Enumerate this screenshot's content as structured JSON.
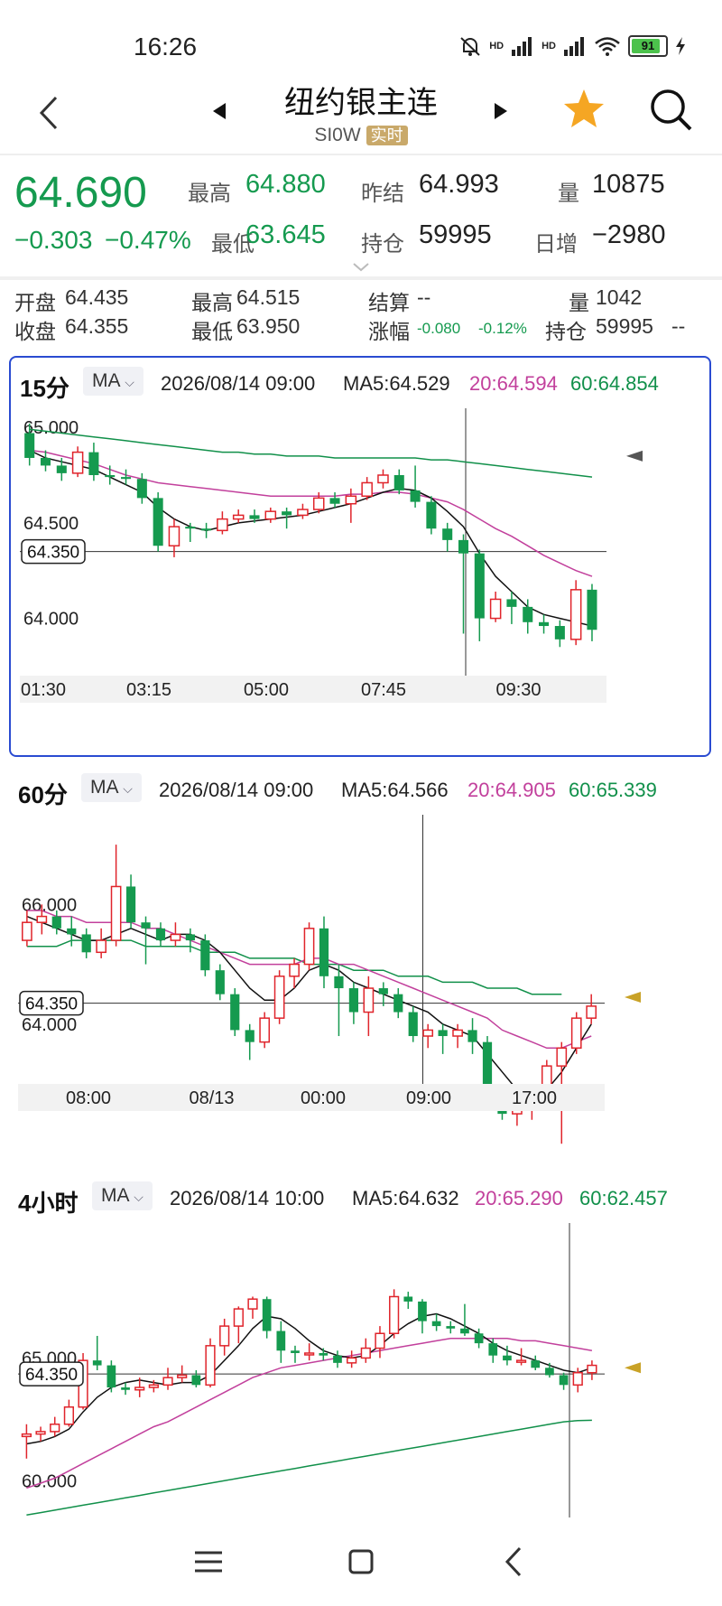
{
  "status": {
    "time": "16:26",
    "battery": "91",
    "net1": "HD",
    "net2": "HD"
  },
  "header": {
    "title": "纽约银主连",
    "symbol": "SI0W",
    "badge": "实时"
  },
  "quote": {
    "price": "64.690",
    "change": "−0.303",
    "change_pct": "−0.47%",
    "high_label": "最高",
    "high": "64.880",
    "low_label": "最低",
    "low": "63.645",
    "prev_label": "昨结",
    "prev": "64.993",
    "oi_label": "持仓",
    "oi": "59995",
    "vol_label": "量",
    "vol": "10875",
    "daily_label": "日增",
    "daily": "−2980"
  },
  "bar_quote": {
    "open_label": "开盘",
    "open": "64.435",
    "close_label": "收盘",
    "close": "64.355",
    "high_label": "最高",
    "high": "64.515",
    "low_label": "最低",
    "low": "63.950",
    "settle_label": "结算",
    "settle": "--",
    "chg_label": "涨幅",
    "chg": "-0.080",
    "chg_pct": "-0.12%",
    "vol_label": "量",
    "vol": "1042",
    "oi_label": "持仓",
    "oi": "59995",
    "oi_tail": "--"
  },
  "colors": {
    "up": "#e0242b",
    "down": "#159a4f",
    "ma5": "#111111",
    "ma20": "#c2409c",
    "ma60": "#11904a",
    "accent": "#f5a623"
  },
  "icons": {
    "back": "back-icon",
    "prev": "triangle-left-icon",
    "next": "triangle-right-icon",
    "star": "star-icon",
    "search": "search-icon"
  },
  "panels": [
    {
      "period": "15分",
      "indicator": "MA",
      "datetime": "2026/08/14 09:00",
      "ma5": "MA5:64.529",
      "ma20": "20:64.594",
      "ma60": "60:64.854",
      "price_tag": "64.350",
      "ylabels": [
        "65.000",
        "64.500",
        "64.000"
      ],
      "xlabels": [
        "01:30",
        "03:15",
        "05:00",
        "07:45",
        "09:30"
      ]
    },
    {
      "period": "60分",
      "indicator": "MA",
      "datetime": "2026/08/14 09:00",
      "ma5": "MA5:64.566",
      "ma20": "20:64.905",
      "ma60": "60:65.339",
      "price_tag": "64.350",
      "ylabels": [
        "66.000",
        "64.000"
      ],
      "xlabels": [
        "08:00",
        "08/13",
        "00:00",
        "09:00",
        "17:00"
      ]
    },
    {
      "period": "4小时",
      "indicator": "MA",
      "datetime": "2026/08/14 10:00",
      "ma5": "MA5:64.632",
      "ma20": "20:65.290",
      "ma60": "60:62.457",
      "price_tag": "64.350",
      "ylabels": [
        "65.000",
        "60.000"
      ],
      "xlabels": []
    }
  ],
  "chart_data": [
    {
      "type": "candlestick",
      "title": "15分",
      "ylim": [
        63.7,
        65.1
      ],
      "candles": [
        [
          64.97,
          64.84,
          65.02,
          64.8
        ],
        [
          64.84,
          64.8,
          64.88,
          64.77
        ],
        [
          64.8,
          64.76,
          64.84,
          64.72
        ],
        [
          64.76,
          64.87,
          64.9,
          64.74
        ],
        [
          64.87,
          64.75,
          64.92,
          64.72
        ],
        [
          64.75,
          64.74,
          64.8,
          64.7
        ],
        [
          64.74,
          64.73,
          64.78,
          64.7
        ],
        [
          64.73,
          64.63,
          64.76,
          64.6
        ],
        [
          64.63,
          64.38,
          64.66,
          64.35
        ],
        [
          64.38,
          64.48,
          64.52,
          64.32
        ],
        [
          64.48,
          64.47,
          64.5,
          64.4
        ],
        [
          64.47,
          64.46,
          64.5,
          64.42
        ],
        [
          64.46,
          64.52,
          64.56,
          64.44
        ],
        [
          64.52,
          64.54,
          64.57,
          64.5
        ],
        [
          64.54,
          64.52,
          64.57,
          64.5
        ],
        [
          64.52,
          64.56,
          64.58,
          64.5
        ],
        [
          64.56,
          64.54,
          64.58,
          64.47
        ],
        [
          64.54,
          64.57,
          64.6,
          64.52
        ],
        [
          64.57,
          64.63,
          64.66,
          64.55
        ],
        [
          64.63,
          64.6,
          64.66,
          64.58
        ],
        [
          64.6,
          64.64,
          64.68,
          64.5
        ],
        [
          64.64,
          64.71,
          64.74,
          64.62
        ],
        [
          64.71,
          64.75,
          64.78,
          64.68
        ],
        [
          64.75,
          64.67,
          64.78,
          64.65
        ],
        [
          64.67,
          64.61,
          64.8,
          64.58
        ],
        [
          64.61,
          64.47,
          64.64,
          64.44
        ],
        [
          64.47,
          64.41,
          64.5,
          64.35
        ],
        [
          64.41,
          64.34,
          64.44,
          63.92
        ],
        [
          64.34,
          64.0,
          64.36,
          63.88
        ],
        [
          64.0,
          64.1,
          64.14,
          63.98
        ],
        [
          64.1,
          64.06,
          64.14,
          63.97
        ],
        [
          64.06,
          63.98,
          64.1,
          63.92
        ],
        [
          63.98,
          63.96,
          64.02,
          63.92
        ],
        [
          63.96,
          63.89,
          63.99,
          63.85
        ],
        [
          63.89,
          64.15,
          64.2,
          63.86
        ],
        [
          64.15,
          63.94,
          64.18,
          63.88
        ]
      ],
      "ma5": [
        64.88,
        64.84,
        64.82,
        64.8,
        64.78,
        64.74,
        64.7,
        64.66,
        64.58,
        64.52,
        64.48,
        64.46,
        64.48,
        64.5,
        64.51,
        64.52,
        64.53,
        64.54,
        64.56,
        64.58,
        64.6,
        64.63,
        64.66,
        64.68,
        64.67,
        64.63,
        64.56,
        64.48,
        64.34,
        64.22,
        64.14,
        64.06,
        64.02,
        64.0,
        63.98,
        63.96
      ],
      "ma20": [
        64.88,
        64.87,
        64.85,
        64.83,
        64.81,
        64.78,
        64.75,
        64.73,
        64.71,
        64.7,
        64.69,
        64.68,
        64.67,
        64.66,
        64.65,
        64.64,
        64.64,
        64.64,
        64.64,
        64.64,
        64.65,
        64.65,
        64.66,
        64.66,
        64.65,
        64.63,
        64.61,
        64.57,
        64.52,
        64.47,
        64.43,
        64.38,
        64.33,
        64.29,
        64.25,
        64.22
      ],
      "ma60": [
        64.99,
        64.98,
        64.97,
        64.96,
        64.95,
        64.94,
        64.93,
        64.92,
        64.91,
        64.9,
        64.89,
        64.88,
        64.87,
        64.87,
        64.86,
        64.86,
        64.85,
        64.85,
        64.85,
        64.84,
        64.84,
        64.84,
        64.84,
        64.84,
        64.84,
        64.83,
        64.83,
        64.82,
        64.81,
        64.8,
        64.79,
        64.78,
        64.77,
        64.76,
        64.75,
        64.74
      ]
    },
    {
      "type": "candlestick",
      "title": "60分",
      "ylim": [
        63.0,
        67.5
      ],
      "candles": [
        [
          65.4,
          65.7,
          65.9,
          65.3
        ],
        [
          65.7,
          65.8,
          66.0,
          65.5
        ],
        [
          65.8,
          65.6,
          65.9,
          65.5
        ],
        [
          65.6,
          65.5,
          65.8,
          65.3
        ],
        [
          65.5,
          65.2,
          65.6,
          65.1
        ],
        [
          65.2,
          65.4,
          65.6,
          65.1
        ],
        [
          65.4,
          66.3,
          67.0,
          65.3
        ],
        [
          66.3,
          65.7,
          66.5,
          65.6
        ],
        [
          65.7,
          65.6,
          65.8,
          65.0
        ],
        [
          65.6,
          65.4,
          65.7,
          65.3
        ],
        [
          65.4,
          65.5,
          65.7,
          65.3
        ],
        [
          65.5,
          65.4,
          65.6,
          65.2
        ],
        [
          65.4,
          64.9,
          65.5,
          64.8
        ],
        [
          64.9,
          64.5,
          65.0,
          64.4
        ],
        [
          64.5,
          63.9,
          64.6,
          63.8
        ],
        [
          63.9,
          63.7,
          64.0,
          63.4
        ],
        [
          63.7,
          64.1,
          64.2,
          63.6
        ],
        [
          64.1,
          64.8,
          64.9,
          64.0
        ],
        [
          64.8,
          65.0,
          65.1,
          64.6
        ],
        [
          65.0,
          65.6,
          65.7,
          64.9
        ],
        [
          65.6,
          64.8,
          65.8,
          64.6
        ],
        [
          64.8,
          64.6,
          65.0,
          63.8
        ],
        [
          64.6,
          64.2,
          64.7,
          64.0
        ],
        [
          64.2,
          64.6,
          64.8,
          63.8
        ],
        [
          64.6,
          64.5,
          64.7,
          64.3
        ],
        [
          64.5,
          64.2,
          64.6,
          64.1
        ],
        [
          64.2,
          63.8,
          64.3,
          63.7
        ],
        [
          63.8,
          63.9,
          64.0,
          63.6
        ],
        [
          63.9,
          63.8,
          64.0,
          63.5
        ],
        [
          63.8,
          63.9,
          64.0,
          63.6
        ],
        [
          63.9,
          63.7,
          64.1,
          63.5
        ],
        [
          63.7,
          62.8,
          63.8,
          62.7
        ],
        [
          62.8,
          62.5,
          62.9,
          62.4
        ],
        [
          62.5,
          62.6,
          62.8,
          62.3
        ],
        [
          62.6,
          62.9,
          63.0,
          62.4
        ],
        [
          62.9,
          63.3,
          63.4,
          62.8
        ],
        [
          63.3,
          63.6,
          63.7,
          62.0
        ],
        [
          63.6,
          64.1,
          64.2,
          63.5
        ],
        [
          64.1,
          64.3,
          64.5,
          64.0
        ]
      ],
      "ma5": [
        65.8,
        65.7,
        65.6,
        65.5,
        65.4,
        65.4,
        65.5,
        65.6,
        65.5,
        65.4,
        65.5,
        65.5,
        65.4,
        65.2,
        64.9,
        64.6,
        64.4,
        64.4,
        64.6,
        64.9,
        65.0,
        64.9,
        64.7,
        64.6,
        64.5,
        64.4,
        64.3,
        64.2,
        64.0,
        63.9,
        63.8,
        63.5,
        63.2,
        62.9,
        62.8,
        62.9,
        63.2,
        63.6,
        64.0
      ],
      "ma20": [
        65.9,
        65.9,
        65.8,
        65.8,
        65.7,
        65.7,
        65.7,
        65.7,
        65.6,
        65.6,
        65.5,
        65.4,
        65.3,
        65.2,
        65.1,
        65.0,
        65.0,
        65.0,
        65.0,
        65.1,
        65.1,
        65.0,
        65.0,
        64.9,
        64.8,
        64.7,
        64.6,
        64.5,
        64.4,
        64.3,
        64.2,
        64.1,
        63.9,
        63.8,
        63.7,
        63.6,
        63.6,
        63.7,
        63.8
      ],
      "ma60": [
        65.3,
        65.3,
        65.3,
        65.4,
        65.4,
        65.4,
        65.4,
        65.4,
        65.3,
        65.3,
        65.3,
        65.3,
        65.2,
        65.2,
        65.2,
        65.1,
        65.1,
        65.1,
        65.1,
        65.0,
        65.0,
        65.0,
        64.9,
        64.9,
        64.9,
        64.8,
        64.8,
        64.8,
        64.7,
        64.7,
        64.7,
        64.6,
        64.6,
        64.6,
        64.5,
        64.5,
        64.5
      ],
      "ma60_len": 37
    },
    {
      "type": "candlestick",
      "title": "4小时",
      "ylim": [
        58.5,
        70.5
      ],
      "candles": [
        [
          61.8,
          61.9,
          62.3,
          60.9
        ],
        [
          61.9,
          62.0,
          62.2,
          61.6
        ],
        [
          62.0,
          62.3,
          62.6,
          61.8
        ],
        [
          62.3,
          63.0,
          63.3,
          62.2
        ],
        [
          63.0,
          64.9,
          65.2,
          62.9
        ],
        [
          64.9,
          64.7,
          65.9,
          64.5
        ],
        [
          64.7,
          63.8,
          64.9,
          63.6
        ],
        [
          63.8,
          63.7,
          64.0,
          63.5
        ],
        [
          63.7,
          63.8,
          64.2,
          63.4
        ],
        [
          63.8,
          63.9,
          64.1,
          63.6
        ],
        [
          63.9,
          64.2,
          64.6,
          63.7
        ],
        [
          64.2,
          64.3,
          64.7,
          64.0
        ],
        [
          64.3,
          63.9,
          64.5,
          63.8
        ],
        [
          63.9,
          65.5,
          65.8,
          63.8
        ],
        [
          65.5,
          66.3,
          66.6,
          65.1
        ],
        [
          66.3,
          67.0,
          67.1,
          65.6
        ],
        [
          67.0,
          67.4,
          67.5,
          66.6
        ],
        [
          67.4,
          66.1,
          67.5,
          65.8
        ],
        [
          66.1,
          65.3,
          66.5,
          64.8
        ],
        [
          65.3,
          65.2,
          65.5,
          64.8
        ],
        [
          65.2,
          65.2,
          65.6,
          64.9
        ],
        [
          65.2,
          65.1,
          65.4,
          64.9
        ],
        [
          65.1,
          64.8,
          65.3,
          64.6
        ],
        [
          64.8,
          65.0,
          65.3,
          64.6
        ],
        [
          65.0,
          65.4,
          65.8,
          64.8
        ],
        [
          65.4,
          66.0,
          66.3,
          65.0
        ],
        [
          66.0,
          67.5,
          67.8,
          65.8
        ],
        [
          67.5,
          67.3,
          67.7,
          67.0
        ],
        [
          67.3,
          66.5,
          67.4,
          66.0
        ],
        [
          66.5,
          66.3,
          66.8,
          66.1
        ],
        [
          66.3,
          66.2,
          66.5,
          66.0
        ],
        [
          66.2,
          66.0,
          67.2,
          65.9
        ],
        [
          66.0,
          65.6,
          66.2,
          65.4
        ],
        [
          65.6,
          65.1,
          65.8,
          64.8
        ],
        [
          65.1,
          64.9,
          65.5,
          64.7
        ],
        [
          64.9,
          64.9,
          65.4,
          64.7
        ],
        [
          64.9,
          64.6,
          65.1,
          64.5
        ],
        [
          64.6,
          64.3,
          64.8,
          64.2
        ],
        [
          64.3,
          63.9,
          64.4,
          63.7
        ],
        [
          63.9,
          64.4,
          64.6,
          63.6
        ],
        [
          64.4,
          64.7,
          64.9,
          64.1
        ]
      ],
      "ma5": [
        61.5,
        61.6,
        61.8,
        62.1,
        62.8,
        63.4,
        63.8,
        64.0,
        64.1,
        64.0,
        63.9,
        64.0,
        64.0,
        64.3,
        64.9,
        65.5,
        66.2,
        66.7,
        66.6,
        66.2,
        65.7,
        65.3,
        65.1,
        65.0,
        65.1,
        65.5,
        66.0,
        66.4,
        66.7,
        66.8,
        66.6,
        66.3,
        66.0,
        65.6,
        65.3,
        65.1,
        64.9,
        64.7,
        64.5,
        64.4,
        64.6
      ],
      "ma20": [
        59.7,
        59.9,
        60.1,
        60.4,
        60.7,
        61.0,
        61.3,
        61.6,
        61.9,
        62.2,
        62.4,
        62.7,
        63.0,
        63.3,
        63.6,
        63.9,
        64.2,
        64.4,
        64.6,
        64.7,
        64.8,
        64.9,
        65.0,
        65.1,
        65.2,
        65.3,
        65.4,
        65.5,
        65.6,
        65.7,
        65.8,
        65.8,
        65.8,
        65.8,
        65.8,
        65.7,
        65.7,
        65.6,
        65.5,
        65.4,
        65.3
      ],
      "ma60": [
        58.6,
        58.7,
        58.8,
        58.9,
        59.0,
        59.1,
        59.2,
        59.3,
        59.4,
        59.5,
        59.6,
        59.7,
        59.8,
        59.9,
        60.0,
        60.1,
        60.2,
        60.3,
        60.4,
        60.5,
        60.6,
        60.7,
        60.8,
        60.9,
        61.0,
        61.1,
        61.2,
        61.3,
        61.4,
        61.5,
        61.6,
        61.7,
        61.8,
        61.9,
        62.0,
        62.1,
        62.2,
        62.3,
        62.4,
        62.45,
        62.46
      ]
    }
  ],
  "nav": {
    "menu": "menu-icon",
    "home": "home-icon",
    "back": "back-icon"
  }
}
